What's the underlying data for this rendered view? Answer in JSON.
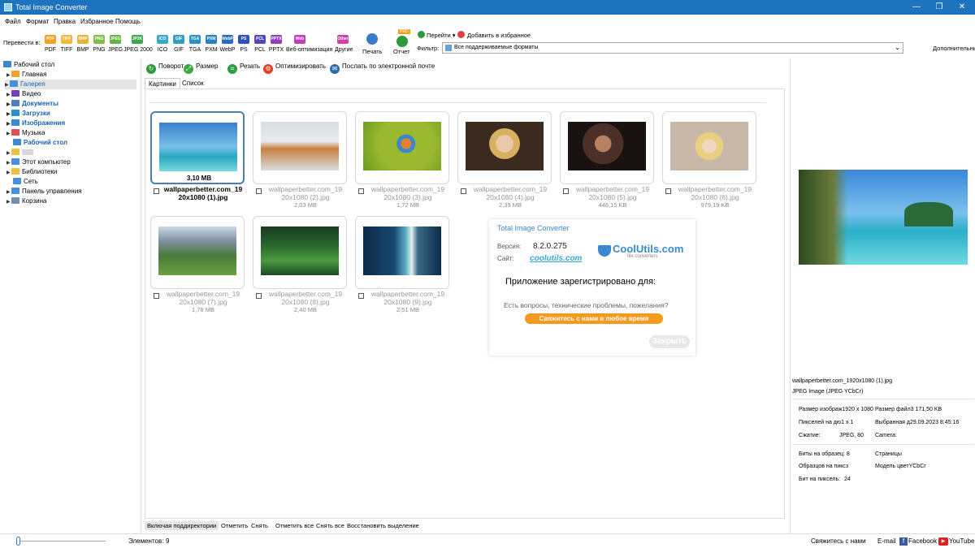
{
  "window": {
    "title": "Total Image Converter"
  },
  "menu": [
    "Файл",
    "Формат",
    "Правка",
    "Избранное",
    "Помощь"
  ],
  "toolbar": {
    "convert_label": "Перевести в:",
    "formats": [
      {
        "label": "PDF",
        "icon": "PDF",
        "color": "#f4a020"
      },
      {
        "label": "TIFF",
        "icon": "TIFF",
        "color": "#f4b83a"
      },
      {
        "label": "BMP",
        "icon": "BMP",
        "color": "#e6b23a"
      },
      {
        "label": "PNG",
        "icon": "PNG",
        "color": "#7cc048"
      },
      {
        "label": "JPEG",
        "icon": "JPEG",
        "color": "#62b53f"
      },
      {
        "label": "JPEG 2000",
        "icon": "JP2K",
        "color": "#3da84a"
      },
      {
        "label": "ICO",
        "icon": "ICO",
        "color": "#3aa8c8"
      },
      {
        "label": "GIF",
        "icon": "GIF",
        "color": "#30a0c0"
      },
      {
        "label": "TGA",
        "icon": "TGA",
        "color": "#2a90c8"
      },
      {
        "label": "PXM",
        "icon": "PXM",
        "color": "#2a80c0"
      },
      {
        "label": "WebP",
        "icon": "WebP",
        "color": "#2a6cc0"
      },
      {
        "label": "PS",
        "icon": "PS",
        "color": "#3050b8"
      },
      {
        "label": "PCL",
        "icon": "PCL",
        "color": "#5048b8"
      },
      {
        "label": "PPTX",
        "icon": "PPTX",
        "color": "#9040b8"
      },
      {
        "label": "Веб-оптимизация",
        "icon": "Web",
        "color": "#c040b8"
      },
      {
        "label": "Другие",
        "icon": "Other",
        "color": "#d040a8"
      }
    ],
    "print_label": "Печать",
    "report_label": "Отчет",
    "pro_badge": "PRO",
    "goto_label": "Перейти",
    "add_fav_label": "Добавить в избранное",
    "filter_label": "Фильтр:",
    "filter_value": "Все поддерживаемые форматы",
    "advanced_label": "Дополнительный"
  },
  "tree": {
    "root": "Рабочий стол",
    "items": [
      {
        "label": "Главная",
        "color": "#f0a030"
      },
      {
        "label": "Галерея",
        "color": "#4a90d8"
      },
      {
        "label": "Видео",
        "color": "#7040c0"
      },
      {
        "label": "Документы",
        "color": "#4a80c8"
      },
      {
        "label": "Загрузки",
        "color": "#2a90d0"
      },
      {
        "label": "Изображения",
        "color": "#3a88d0"
      },
      {
        "label": "Музыка",
        "color": "#e05050"
      },
      {
        "label": "Рабочий стол",
        "color": "#3a88d0"
      },
      {
        "label": "",
        "color": "#f0c040"
      },
      {
        "label": "Этот компьютер",
        "color": "#4a90d8"
      },
      {
        "label": "Библиотеки",
        "color": "#f0c040"
      },
      {
        "label": "Сеть",
        "color": "#4a90d8"
      },
      {
        "label": "Панель управления",
        "color": "#4a90d8"
      },
      {
        "label": "Корзина",
        "color": "#7090b0"
      }
    ]
  },
  "actions": [
    {
      "label": "Поворот",
      "color": "#2a9a3a"
    },
    {
      "label": "Размер",
      "color": "#3aaa3a"
    },
    {
      "label": "Резать",
      "color": "#2aa040"
    },
    {
      "label": "Оптимизировать",
      "color": "#e04020"
    },
    {
      "label": "Послать по электронной почте",
      "color": "#2a6cb0"
    }
  ],
  "tabs": [
    "Картинки",
    "Список"
  ],
  "files": [
    {
      "name_line1": "wallpaperbetter.com_19",
      "name_line2": "20x1080 (1).jpg",
      "size": "3,10 MB",
      "selected": true
    },
    {
      "name_line1": "wallpaperbetter.com_19",
      "name_line2": "20x1080 (2).jpg",
      "size": "2,03 MB"
    },
    {
      "name_line1": "wallpaperbetter.com_19",
      "name_line2": "20x1080 (3).jpg",
      "size": "1,72 MB"
    },
    {
      "name_line1": "wallpaperbetter.com_19",
      "name_line2": "20x1080 (4).jpg",
      "size": "2,39 MB"
    },
    {
      "name_line1": "wallpaperbetter.com_19",
      "name_line2": "20x1080 (5).jpg",
      "size": "446,15 KB"
    },
    {
      "name_line1": "wallpaperbetter.com_19",
      "name_line2": "20x1080 (6).jpg",
      "size": "979,19 KB"
    },
    {
      "name_line1": "wallpaperbetter.com_19",
      "name_line2": "20x1080 (7).jpg",
      "size": "1,78 MB"
    },
    {
      "name_line1": "wallpaperbetter.com_19",
      "name_line2": "20x1080 (8).jpg",
      "size": "2,40 MB"
    },
    {
      "name_line1": "wallpaperbetter.com_19",
      "name_line2": "20x1080 (9).jpg",
      "size": "2,51 MB"
    }
  ],
  "about": {
    "title": "Total Image Converter",
    "version_label": "Версия:",
    "version": "8.2.0.275",
    "site_label": "Сайт:",
    "site": "coolutils.com",
    "logo_text": "CoolUtils.com",
    "logo_sub": "file converters",
    "registered": "Приложение зарегистрировано для:",
    "question": "Есть вопросы, технические проблемы, пожелания?",
    "contact_button": "Свяжитесь с нами в любое время",
    "close_button": "Закрыть"
  },
  "bottom_bar": [
    "Включая поддиректории",
    "Отметить",
    "Снять",
    "Отметить все",
    "Снять все",
    "Восстановить выделение"
  ],
  "details": {
    "filename": "wallpaperbetter.com_1920x1080 (1).jpg",
    "format": "JPEG Image (JPEG YCbCr)",
    "rows": [
      "Размер изображ1920 x 1080",
      "Размер файл3 171,50 KB",
      "Пикселей на дю1 x 1",
      "Выбранная д29.09.2023 8:45:16",
      "Сжатие:",
      "JPEG, 80",
      "Camera:",
      "Биты на образец: 8",
      "Страницы",
      "Образцов на пиксз",
      "Модель цветYCbCr",
      "Бит на пиксель:",
      "24"
    ]
  },
  "status": {
    "elements_label": "Элементов:",
    "elements_count": "9",
    "contact": "Свяжитесь с нами",
    "email": "E-mail",
    "facebook": "Facebook",
    "youtube": "YouTube",
    "zoom_level": 0
  }
}
